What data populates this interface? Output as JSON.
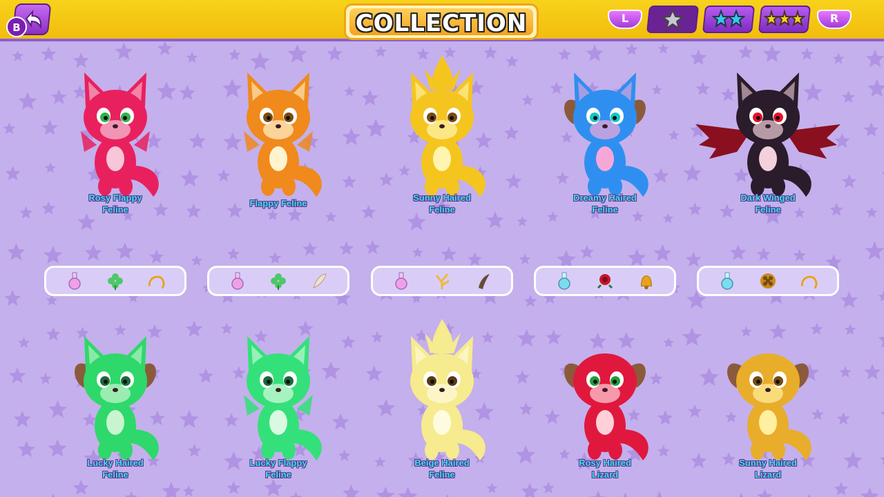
{
  "header": {
    "title": "COLLECTION",
    "back_button_key": "B",
    "left_shoulder": "L",
    "right_shoulder": "R",
    "tabs": [
      {
        "name": "one-star",
        "stars": 1,
        "star_color": "#c8c8d0",
        "active": true
      },
      {
        "name": "two-star",
        "stars": 2,
        "star_color": "#34c7f0",
        "active": false
      },
      {
        "name": "three-star",
        "stars": 3,
        "star_color": "#f7d21b",
        "active": false
      }
    ]
  },
  "creatures_row1": [
    {
      "name": "Rosy Flappy\nFeline",
      "color": "#e8215e",
      "accent": "#f7c6d8",
      "eye": "#2fb24a",
      "kind": "feline-wings"
    },
    {
      "name": "Flappy Feline",
      "color": "#f08a1c",
      "accent": "#fff3d0",
      "eye": "#7a4a12",
      "kind": "feline-wings"
    },
    {
      "name": "Sunny Haired\nFeline",
      "color": "#f5c51f",
      "accent": "#fff5b0",
      "eye": "#7a4a12",
      "kind": "feline-hair"
    },
    {
      "name": "Dreamy Haired\nFeline",
      "color": "#2f8ff0",
      "accent": "#f5a8d8",
      "eye": "#12c6c6",
      "kind": "feline-horns"
    },
    {
      "name": "Dark Winged\nFeline",
      "color": "#2a1c2a",
      "accent": "#f2d0dc",
      "eye": "#e8102a",
      "kind": "feline-bigwings"
    }
  ],
  "item_sets": [
    [
      "pink-potion-icon",
      "clover-icon",
      "gold-ring-icon"
    ],
    [
      "pink-potion-icon",
      "clover-icon",
      "feather-quill-icon"
    ],
    [
      "pink-potion-icon",
      "golden-branch-icon",
      "claw-icon"
    ],
    [
      "blue-potion-icon",
      "rose-icon",
      "bell-icon"
    ],
    [
      "blue-potion-icon",
      "honeycomb-icon",
      "gold-ring-icon"
    ]
  ],
  "creatures_row2": [
    {
      "name": "Lucky Haired\nFeline",
      "color": "#2fd86a",
      "accent": "#c8f5d0",
      "eye": "#1a6a3a",
      "kind": "feline-horns"
    },
    {
      "name": "Lucky Flappy\nFeline",
      "color": "#34e07a",
      "accent": "#d8fae0",
      "eye": "#1a6a3a",
      "kind": "feline-wings"
    },
    {
      "name": "Beige Haired\nFeline",
      "color": "#f6eb8e",
      "accent": "#fffbe0",
      "eye": "#5a3a12",
      "kind": "feline-hair"
    },
    {
      "name": "Rosy Haired\nLizard",
      "color": "#e0183e",
      "accent": "#ffd0d8",
      "eye": "#1f9c3a",
      "kind": "lizard"
    },
    {
      "name": "Sunny Haired\nLizard",
      "color": "#e8ad2a",
      "accent": "#fff0a0",
      "eye": "#7a4a12",
      "kind": "lizard"
    }
  ]
}
